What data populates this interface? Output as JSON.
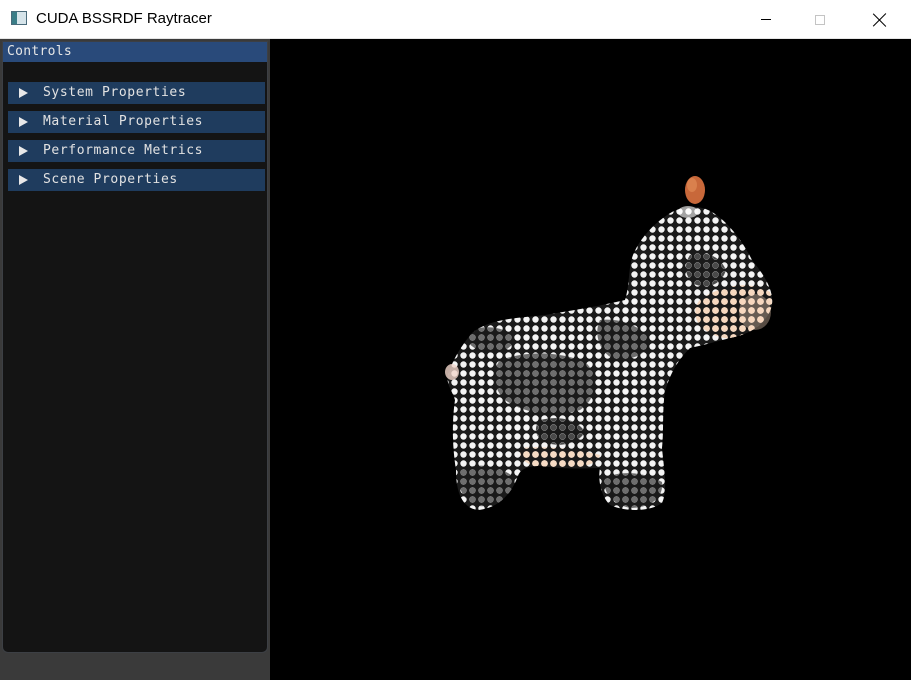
{
  "window": {
    "title": "CUDA BSSRDF Raytracer",
    "icon": "app-window-icon",
    "controls": [
      "minimize-icon",
      "maximize-icon",
      "close-icon"
    ]
  },
  "panel": {
    "title": "Controls",
    "headers": [
      {
        "label": "System Properties",
        "icon": "triangle-right-icon"
      },
      {
        "label": "Material Properties",
        "icon": "triangle-right-icon"
      },
      {
        "label": "Performance Metrics",
        "icon": "triangle-right-icon"
      },
      {
        "label": "Scene Properties",
        "icon": "triangle-right-icon"
      }
    ]
  },
  "scene": {
    "subject": "cow model rendered with dotted BSSRDF material",
    "background": "#000000"
  },
  "colors": {
    "panel_bg": "#141414",
    "panel_title": "#294a7a",
    "header_bg": "#1f3c5e",
    "horn": "#c8683a",
    "skin": "#f2c4a8"
  }
}
